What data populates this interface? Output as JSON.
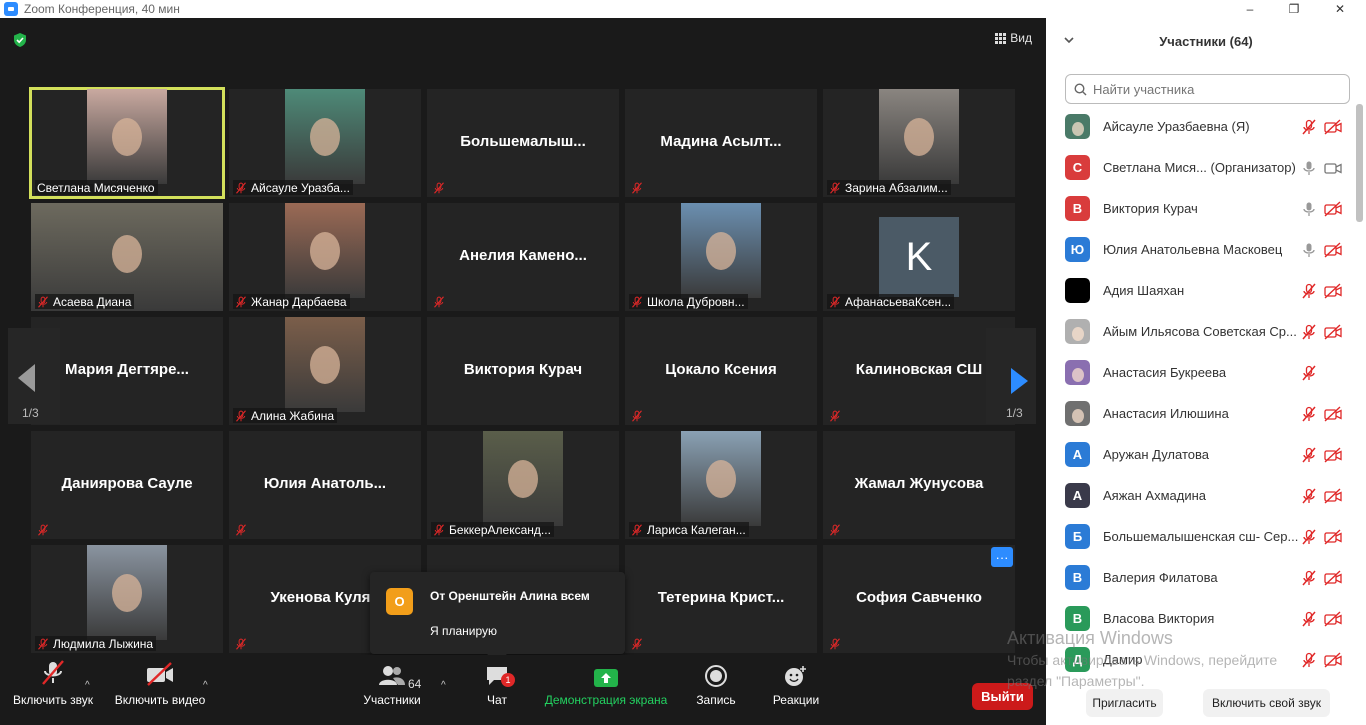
{
  "window": {
    "title": "Zoom Конференция, 40 мин",
    "minimize": "–",
    "maximize": "❐",
    "close": "✕"
  },
  "view_label": "Вид",
  "page_left": "1/3",
  "page_right": "1/3",
  "tiles": [
    {
      "name": "Светлана Мисяченко",
      "big": "",
      "photo": "#c9a9a0",
      "active": true,
      "muted": false
    },
    {
      "name": "Айсауле Уразба...",
      "big": "",
      "photo": "#4e8a78",
      "muted": true
    },
    {
      "name": "",
      "big": "Большемалыш...",
      "muted": true
    },
    {
      "name": "",
      "big": "Мадина  Асылт...",
      "muted": true
    },
    {
      "name": "Зарина Абзалим...",
      "big": "",
      "photo": "#8a8580",
      "muted": true
    },
    {
      "name": "Асаева Диана",
      "big": "",
      "photo": "#6d6a5e",
      "muted": true,
      "wide": true
    },
    {
      "name": "Жанар Дарбаева",
      "big": "",
      "photo": "#9b6a55",
      "muted": true
    },
    {
      "name": "",
      "big": "Анелия  Камено...",
      "muted": true
    },
    {
      "name": "Школа Дубровн...",
      "big": "",
      "photo": "#6b8fb0",
      "muted": true
    },
    {
      "name": "АфанасьеваКсен...",
      "big": "",
      "letter": "K",
      "muted": true
    },
    {
      "name": "",
      "big": "Мария  Дегтяре...",
      "muted": false
    },
    {
      "name": "Алина Жабина",
      "big": "",
      "photo": "#7b5e4a",
      "muted": true
    },
    {
      "name": "",
      "big": "Виктория Курач",
      "muted": false
    },
    {
      "name": "",
      "big": "Цокало Ксения",
      "muted": true
    },
    {
      "name": "",
      "big": "Калиновская СШ",
      "muted": true
    },
    {
      "name": "",
      "big": "Даниярова Сауле",
      "muted": true
    },
    {
      "name": "",
      "big": "Юлия  Анатоль...",
      "muted": true
    },
    {
      "name": "БеккерАлександ...",
      "big": "",
      "photo": "#5a5e4a",
      "muted": true
    },
    {
      "name": "Лариса Калеган...",
      "big": "",
      "photo": "#8aa1b4",
      "muted": true
    },
    {
      "name": "",
      "big": "Жамал Жунусова",
      "muted": true
    },
    {
      "name": "Людмила Лыжина",
      "big": "",
      "photo": "#8a94a0",
      "muted": true
    },
    {
      "name": "",
      "big": "Укенова Кулян",
      "muted": true
    },
    {
      "name": "",
      "big": "",
      "muted": false
    },
    {
      "name": "",
      "big": "Тетерина  Крист...",
      "muted": true
    },
    {
      "name": "",
      "big": "София Савченко",
      "muted": true,
      "more": true
    }
  ],
  "chat_popup": {
    "avatar": "О",
    "from": "От Оренштейн Алина всем",
    "message": "Я планирую"
  },
  "toolbar": {
    "unmute": "Включить звук",
    "start_video": "Включить видео",
    "participants": "Участники",
    "participants_count": "64",
    "chat": "Чат",
    "chat_badge": "1",
    "share": "Демонстрация экрана",
    "record": "Запись",
    "reactions": "Реакции",
    "leave": "Выйти"
  },
  "panel": {
    "title": "Участники (64)",
    "search_placeholder": "Найти участника",
    "participants": [
      {
        "name": "Айсауле Уразбаевна (Я)",
        "avatar": "",
        "color": "#4a7a68",
        "mic": "off",
        "cam": "off"
      },
      {
        "name": "Светлана Мися...  (Организатор)",
        "avatar": "С",
        "color": "#d93c3c",
        "mic": "on",
        "cam": "on"
      },
      {
        "name": "Виктория Курач",
        "avatar": "В",
        "color": "#d93c3c",
        "mic": "on",
        "cam": "off"
      },
      {
        "name": "Юлия Анатольевна  Масковец",
        "avatar": "Ю",
        "color": "#2b7bd6",
        "mic": "on",
        "cam": "off"
      },
      {
        "name": "Адия Шаяхан",
        "avatar": "",
        "color": "#000000",
        "mic": "off",
        "cam": "off"
      },
      {
        "name": "Айым Ильясова Советская Ср...",
        "avatar": "",
        "color": "#b0b0b0",
        "mic": "off",
        "cam": "off"
      },
      {
        "name": "Анастасия Букреева",
        "avatar": "",
        "color": "#8a6fb0",
        "mic": "off",
        "cam": "none"
      },
      {
        "name": "Анастасия Илюшина",
        "avatar": "",
        "color": "#707070",
        "mic": "off",
        "cam": "off"
      },
      {
        "name": "Аружан Дулатова",
        "avatar": "А",
        "color": "#2b7bd6",
        "mic": "off",
        "cam": "off"
      },
      {
        "name": "Аяжан Ахмадина",
        "avatar": "А",
        "color": "#3a3a4a",
        "mic": "off",
        "cam": "off"
      },
      {
        "name": "Большемалышенская сш- Сер...",
        "avatar": "Б",
        "color": "#2b7bd6",
        "mic": "off",
        "cam": "off"
      },
      {
        "name": "Валерия Филатова",
        "avatar": "В",
        "color": "#2b7bd6",
        "mic": "off",
        "cam": "off"
      },
      {
        "name": "Власова Виктория",
        "avatar": "В",
        "color": "#2a9a5a",
        "mic": "off",
        "cam": "off"
      },
      {
        "name": "Дамир",
        "avatar": "Д",
        "color": "#2a9a5a",
        "mic": "off",
        "cam": "off"
      }
    ],
    "invite": "Пригласить",
    "unmute_me": "Включить свой звук"
  },
  "watermark": {
    "line1": "Активация Windows",
    "line2": "Чтобы активировать Windows, перейдите",
    "line3": "раздел \"Параметры\"."
  }
}
